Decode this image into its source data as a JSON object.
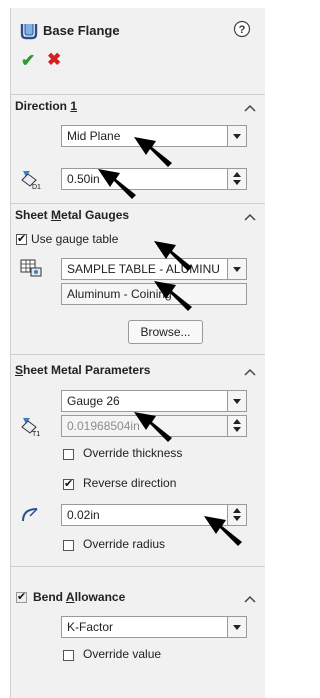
{
  "header": {
    "title": "Base Flange"
  },
  "direction1": {
    "title_before": "Direction ",
    "title_underlined": "1",
    "end_condition": "Mid Plane",
    "depth_value": "0.50in",
    "depth_icon_label": "D1"
  },
  "gauges": {
    "title_before": "Sheet ",
    "title_underlined": "M",
    "title_after": "etal Gauges",
    "use_gauge_table_label": "Use gauge table",
    "table_value": "SAMPLE TABLE - ALUMINU",
    "material_value": "Aluminum - Coining",
    "browse_label": "Browse..."
  },
  "parameters": {
    "title_underlined": "S",
    "title_after": "heet Metal Parameters",
    "gauge_value": "Gauge 26",
    "thickness_value": "0.01968504in",
    "thickness_icon_label": "T1",
    "override_thickness_label": "Override thickness",
    "reverse_direction_label": "Reverse direction",
    "radius_value": "0.02in",
    "override_radius_label": "Override radius"
  },
  "bend": {
    "title_before": "Bend ",
    "title_underlined": "A",
    "title_after": "llowance",
    "type_value": "K-Factor",
    "override_value_label": "Override value"
  },
  "colors": {
    "accept": "#2e9b2e",
    "cancel": "#d42020"
  }
}
